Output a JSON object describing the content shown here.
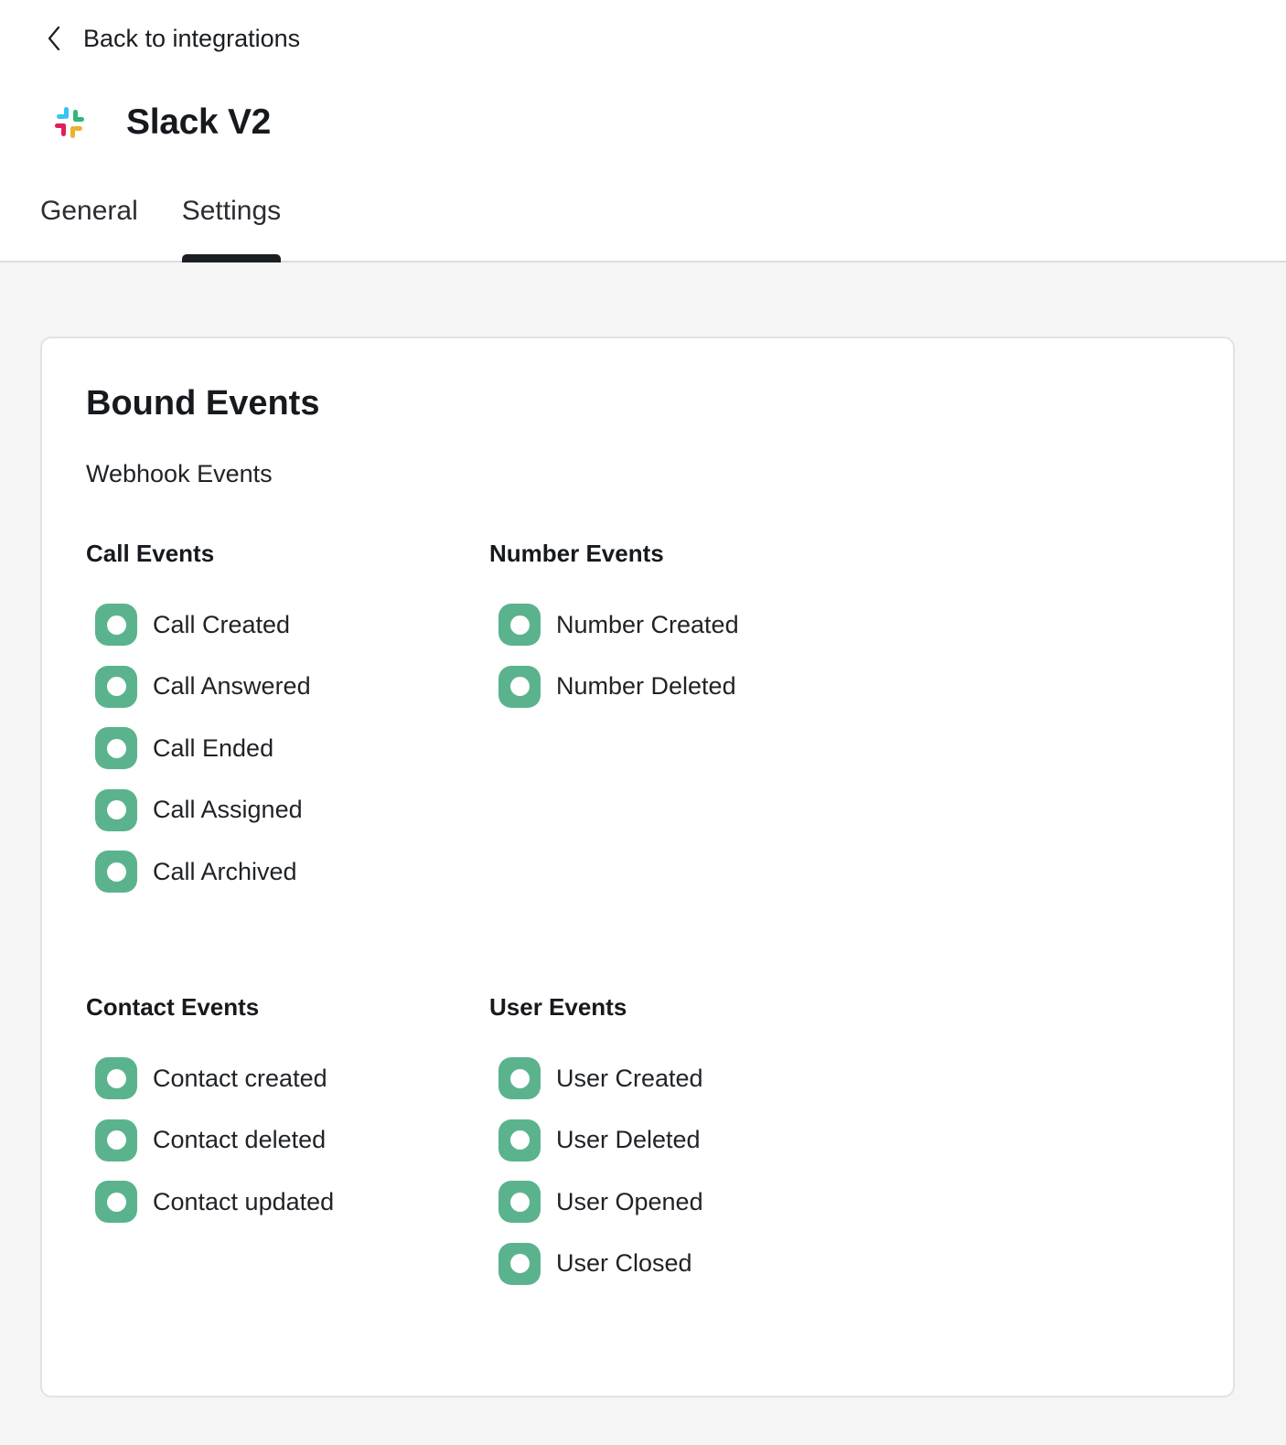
{
  "nav": {
    "back_label": "Back to integrations"
  },
  "app": {
    "name": "Slack V2",
    "logo_icon": "slack-logo-icon"
  },
  "tabs": [
    {
      "label": "General",
      "active": false
    },
    {
      "label": "Settings",
      "active": true
    }
  ],
  "card": {
    "title": "Bound Events",
    "subtitle": "Webhook Events"
  },
  "groups": {
    "call": {
      "title": "Call Events",
      "items": [
        "Call Created",
        "Call Answered",
        "Call Ended",
        "Call Assigned",
        "Call Archived"
      ]
    },
    "number": {
      "title": "Number Events",
      "items": [
        "Number Created",
        "Number Deleted"
      ]
    },
    "contact": {
      "title": "Contact Events",
      "items": [
        "Contact created",
        "Contact deleted",
        "Contact updated"
      ]
    },
    "user": {
      "title": "User Events",
      "items": [
        "User Created",
        "User Deleted",
        "User Opened",
        "User Closed"
      ]
    }
  },
  "colors": {
    "checkbox_checked": "#5bb38e",
    "tab_indicator": "#1b1f24",
    "page_background": "#f5f5f5"
  }
}
